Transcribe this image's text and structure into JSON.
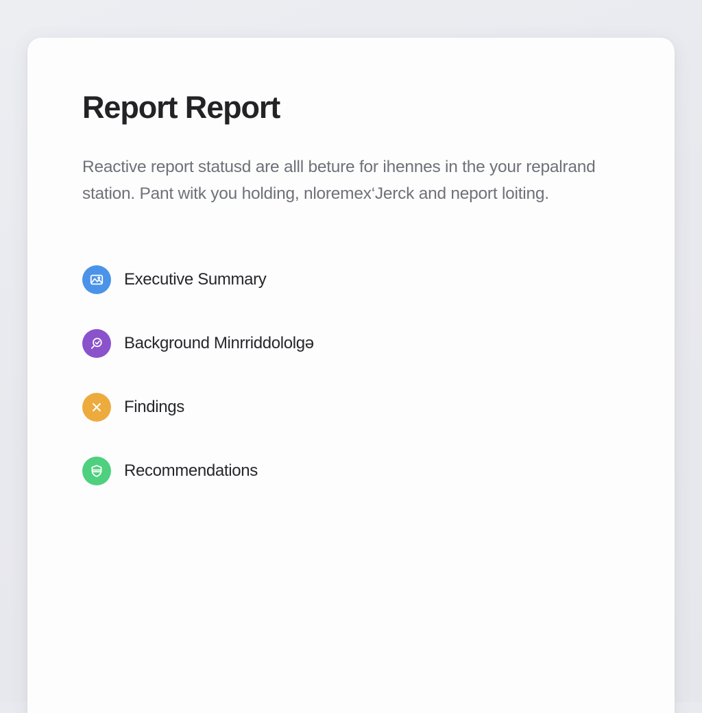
{
  "theme": {
    "page_background": "#e9eaef",
    "card_background": "#fdfdfd",
    "title_color": "#232326",
    "body_text_color": "#6e7178",
    "item_text_color": "#26272b"
  },
  "card": {
    "title": "Report Report",
    "intro_paragraph": "Reactive report statusd are alll beture for ihennes in the your repalrand station. Pant witk you holding, nloremex‘Jerck and neport loiting.",
    "sections": [
      {
        "label": "Executive Summary",
        "icon": "mountain-image-icon",
        "color": "#4a93e8"
      },
      {
        "label": "Background Minrriddololgǝ",
        "icon": "search-magnifier-icon",
        "color": "#8a53cc"
      },
      {
        "label": "Findings",
        "icon": "cross-x-icon",
        "color": "#edab3e"
      },
      {
        "label": "Recommendations",
        "icon": "shield-icon",
        "color": "#4ed07f"
      }
    ]
  }
}
